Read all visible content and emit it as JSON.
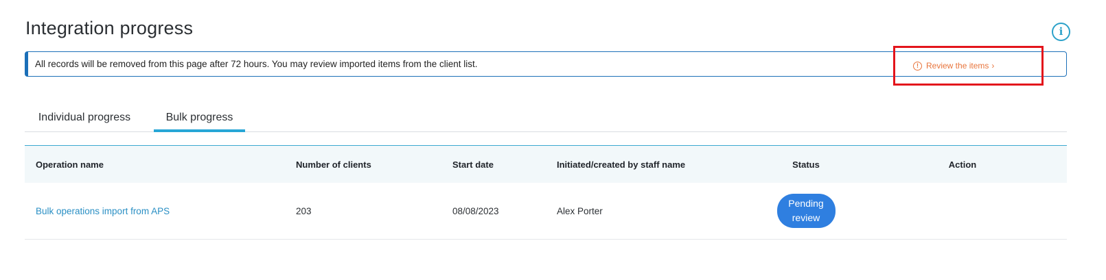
{
  "header": {
    "title": "Integration progress",
    "info_icon": "info-icon"
  },
  "notice": {
    "text": "All records will be removed from this page after 72 hours. You may review imported items from the client list."
  },
  "tabs": [
    {
      "label": "Individual progress",
      "active": false
    },
    {
      "label": "Bulk progress",
      "active": true
    }
  ],
  "table": {
    "columns": [
      "Operation name",
      "Number of clients",
      "Start date",
      "Initiated/created by staff name",
      "Status",
      "Action"
    ],
    "rows": [
      {
        "operation_name": "Bulk operations import from APS",
        "number_of_clients": "203",
        "start_date": "08/08/2023",
        "staff_name": "Alex Porter",
        "status_line1": "Pending",
        "status_line2": "review",
        "action_label": "Review the items",
        "action_icon": "warning-circle-icon",
        "action_chevron": "›"
      }
    ]
  },
  "colors": {
    "accent": "#27a6d6",
    "link": "#2a8fc4",
    "status_badge": "#2f7fe0",
    "action": "#e8743b",
    "highlight_box": "#e3141b"
  }
}
